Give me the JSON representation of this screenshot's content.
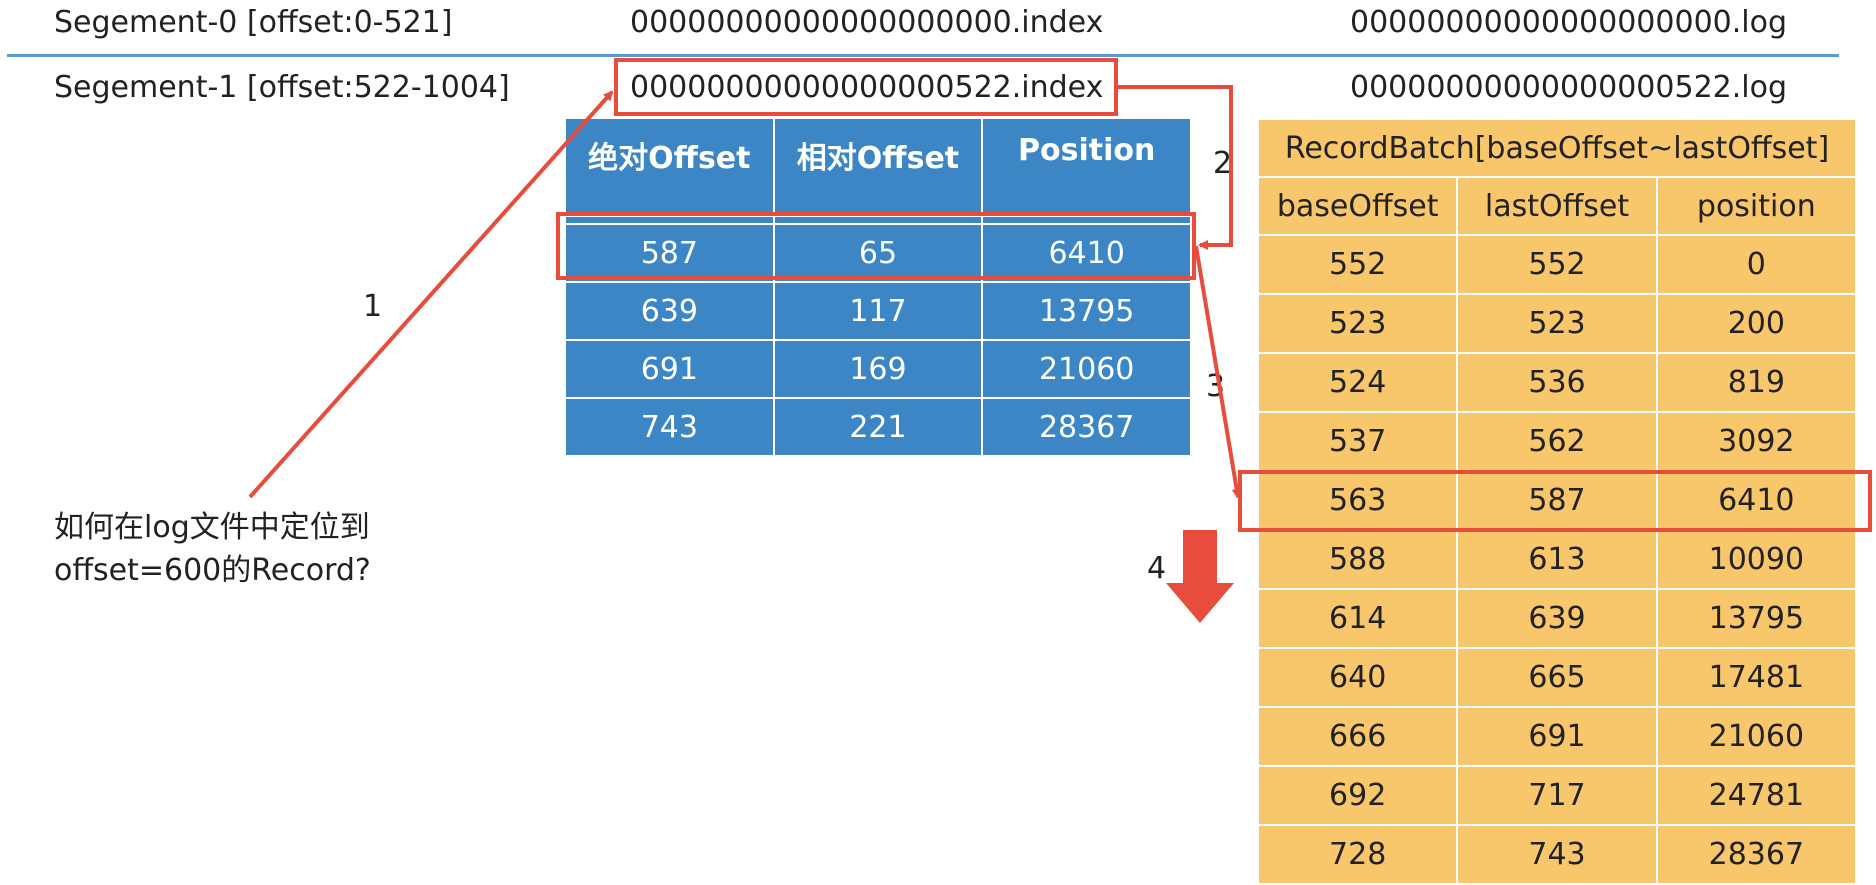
{
  "segments": [
    {
      "label": "Segement-0 [offset:0-521]",
      "index_file": "00000000000000000000.index",
      "log_file": "00000000000000000000.log"
    },
    {
      "label": "Segement-1 [offset:522-1004]",
      "index_file": "00000000000000000522.index",
      "log_file": "00000000000000000522.log"
    }
  ],
  "index_table": {
    "headers": [
      "绝对Offset",
      "相对Offset",
      "Position"
    ],
    "rows": [
      [
        "587",
        "65",
        "6410"
      ],
      [
        "639",
        "117",
        "13795"
      ],
      [
        "691",
        "169",
        "21060"
      ],
      [
        "743",
        "221",
        "28367"
      ]
    ],
    "highlighted_row": 0
  },
  "log_table": {
    "caption": "RecordBatch[baseOffset~lastOffset]",
    "headers": [
      "baseOffset",
      "lastOffset",
      "position"
    ],
    "rows": [
      [
        "552",
        "552",
        "0"
      ],
      [
        "523",
        "523",
        "200"
      ],
      [
        "524",
        "536",
        "819"
      ],
      [
        "537",
        "562",
        "3092"
      ],
      [
        "563",
        "587",
        "6410"
      ],
      [
        "588",
        "613",
        "10090"
      ],
      [
        "614",
        "639",
        "13795"
      ],
      [
        "640",
        "665",
        "17481"
      ],
      [
        "666",
        "691",
        "21060"
      ],
      [
        "692",
        "717",
        "24781"
      ],
      [
        "728",
        "743",
        "28367"
      ]
    ],
    "highlighted_row": 4
  },
  "steps": [
    "1",
    "2",
    "3",
    "4"
  ],
  "question": {
    "line1": "如何在log文件中定位到",
    "line2": "offset=600的Record?"
  },
  "colors": {
    "accent": "#e74c3c",
    "index_bg": "#3c86c6",
    "log_bg": "#f8c76b",
    "divider": "#5b9bd5"
  }
}
